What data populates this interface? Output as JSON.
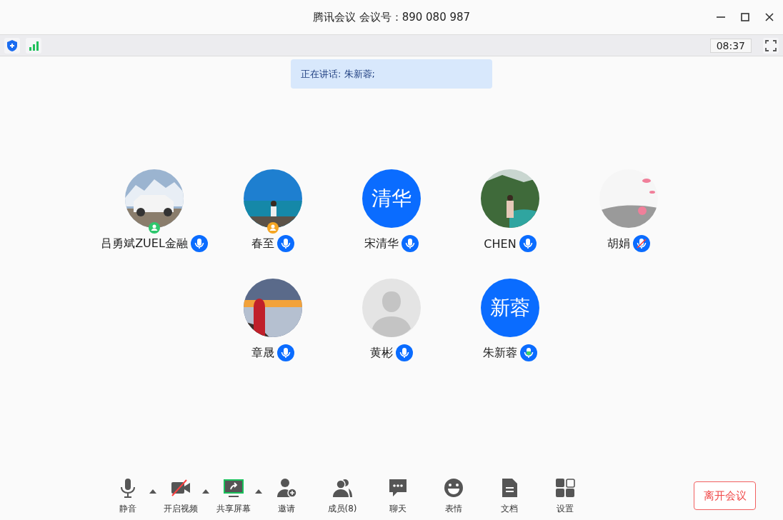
{
  "window": {
    "title": "腾讯会议 会议号：890 080 987"
  },
  "status": {
    "time": "08:37"
  },
  "speaking_banner": "正在讲话: 朱新蓉;",
  "participants": [
    {
      "name": "吕勇斌ZUEL金融",
      "kind": "picture",
      "color": "#2dc76d",
      "muted": false,
      "speaking": false
    },
    {
      "name": "春至",
      "kind": "picture",
      "color": "#f5a623",
      "muted": false,
      "speaking": false
    },
    {
      "name": "宋清华",
      "kind": "initials",
      "initials": "清华",
      "muted": false,
      "speaking": false
    },
    {
      "name": "CHEN",
      "kind": "picture",
      "muted": false,
      "speaking": false
    },
    {
      "name": "胡娟",
      "kind": "picture",
      "muted": true,
      "speaking": false
    },
    {
      "name": "章晟",
      "kind": "picture",
      "muted": false,
      "speaking": false
    },
    {
      "name": "黄彬",
      "kind": "placeholder",
      "muted": false,
      "speaking": false
    },
    {
      "name": "朱新蓉",
      "kind": "initials",
      "initials": "新蓉",
      "muted": false,
      "speaking": true
    }
  ],
  "toolbar": [
    {
      "label": "静音",
      "kind": "mic",
      "menu": true
    },
    {
      "label": "开启视频",
      "kind": "video",
      "menu": true,
      "on": false
    },
    {
      "label": "共享屏幕",
      "kind": "share",
      "menu": true
    },
    {
      "label": "邀请",
      "kind": "invite",
      "menu": false
    },
    {
      "label": "成员(8)",
      "kind": "members",
      "menu": false
    },
    {
      "label": "聊天",
      "kind": "chat",
      "menu": false
    },
    {
      "label": "表情",
      "kind": "emoji",
      "menu": false
    },
    {
      "label": "文档",
      "kind": "doc",
      "menu": false
    },
    {
      "label": "设置",
      "kind": "settings",
      "menu": false
    }
  ],
  "leave_button": "离开会议"
}
